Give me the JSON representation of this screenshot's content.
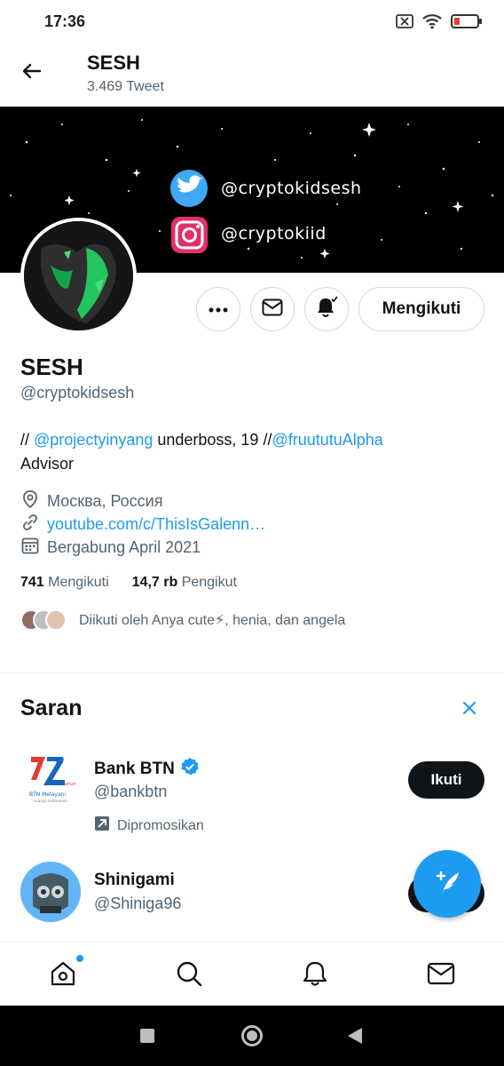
{
  "status_bar": {
    "time": "17:36"
  },
  "header": {
    "name": "SESH",
    "tweet_count": "3.469 Tweet"
  },
  "banner": {
    "twitter_handle": "@cryptokidsesh",
    "instagram_handle": "@cryptokiid"
  },
  "profile": {
    "name": "SESH",
    "handle": "@cryptokidsesh",
    "follow_label": "Mengikuti",
    "bio": {
      "prefix": "// ",
      "mention1": "@projectyinyang",
      "middle": " underboss, 19 //",
      "mention2": "@fruututuAlpha",
      "line2": "Advisor"
    },
    "location": "Москва, Россия",
    "link": "youtube.com/c/ThisIsGalenn…",
    "joined": "Bergabung April 2021",
    "following_count": "741",
    "following_label": "Mengikuti",
    "followers_count": "14,7 rb",
    "followers_label": "Pengikut",
    "followed_by": "Diikuti oleh Anya cute⚡, henia, dan angela"
  },
  "suggestions": {
    "title": "Saran",
    "items": [
      {
        "name": "Bank BTN",
        "handle": "@bankbtn",
        "promoted": "Dipromosikan",
        "button": "Ikuti"
      },
      {
        "name": "Shinigami",
        "handle": "@Shiniga96"
      }
    ]
  },
  "icons": {
    "back": "arrow-left-icon",
    "more": "more-icon",
    "message": "mail-icon",
    "notify": "bell-icon",
    "location": "location-pin-icon",
    "link": "link-icon",
    "calendar": "calendar-icon",
    "close": "close-icon",
    "compose": "compose-icon"
  },
  "colors": {
    "accent": "#1d9bf0",
    "text": "#0f1419",
    "muted": "#536471",
    "border": "#cfd9de"
  }
}
